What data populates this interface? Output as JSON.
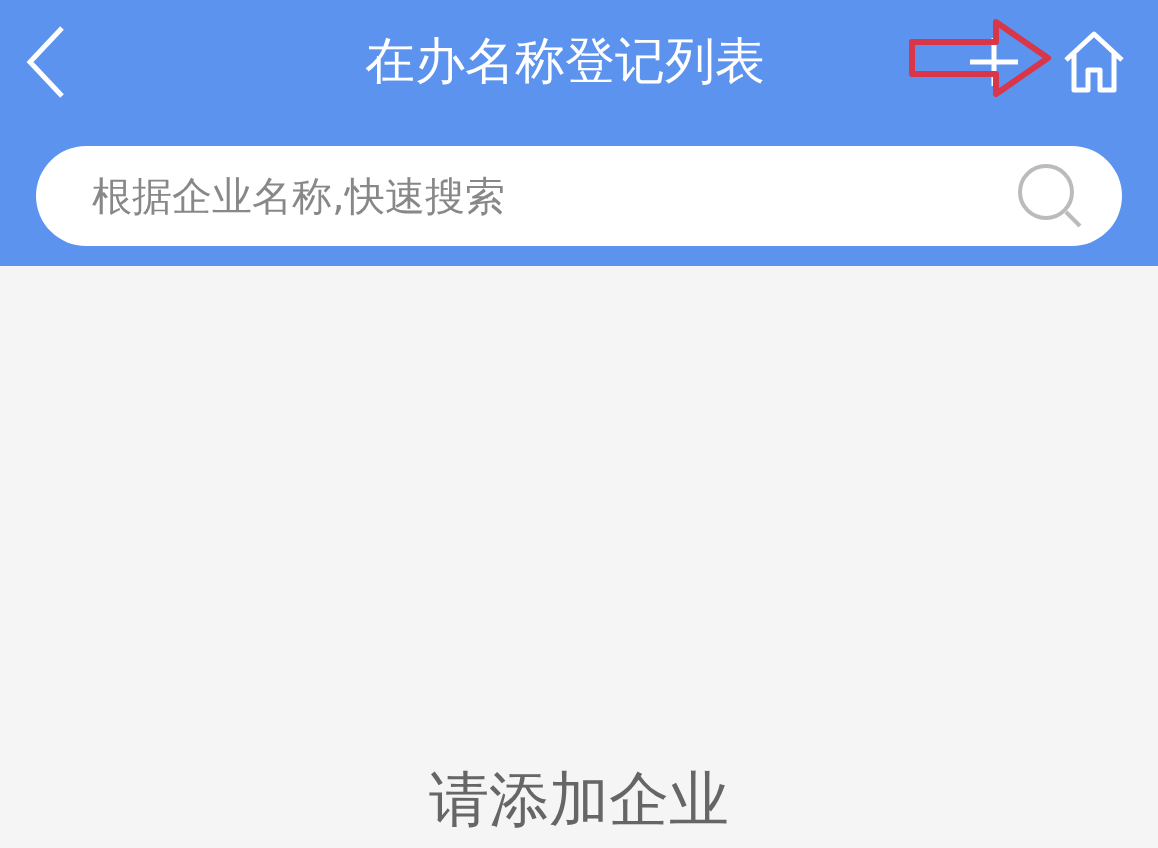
{
  "header": {
    "title": "在办名称登记列表"
  },
  "search": {
    "placeholder": "根据企业名称,快速搜索"
  },
  "empty_state": {
    "text": "请添加企业"
  }
}
